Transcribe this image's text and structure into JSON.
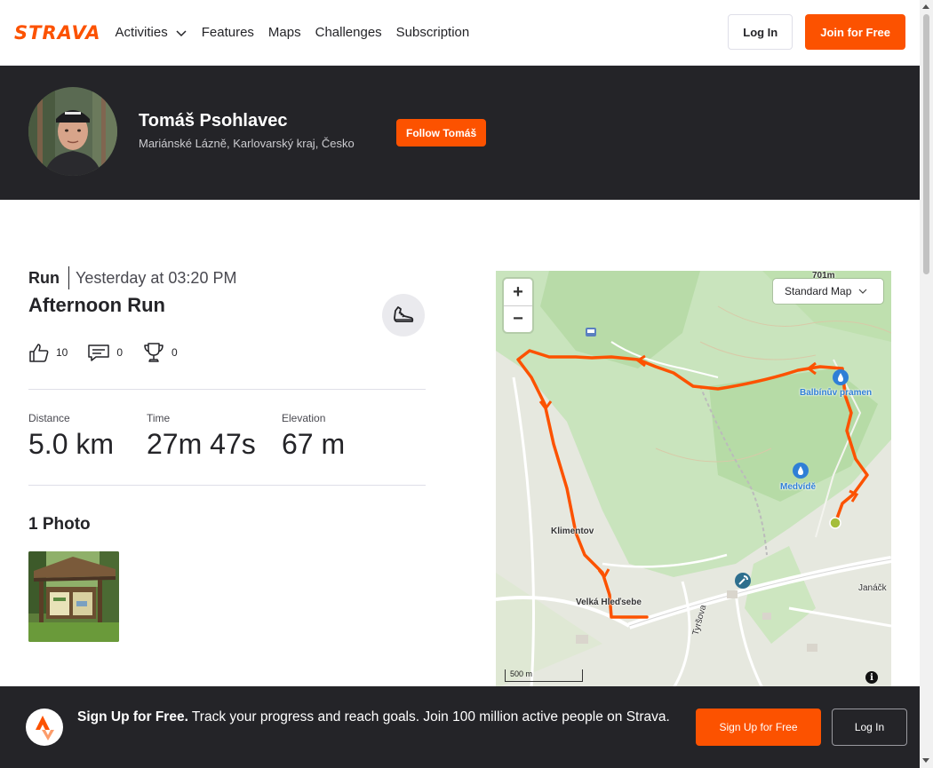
{
  "header": {
    "logo": "STRAVA",
    "nav": [
      "Activities",
      "Features",
      "Maps",
      "Challenges",
      "Subscription"
    ],
    "login_label": "Log In",
    "join_label": "Join for Free",
    "brand_color": "#fc5200"
  },
  "athlete": {
    "name": "Tomáš Psohlavec",
    "location": "Mariánské Lázně, Karlovarský kraj, Česko",
    "follow_label": "Follow Tomáš"
  },
  "activity": {
    "type": "Run",
    "time": "Yesterday at 03:20 PM",
    "title": "Afternoon Run",
    "kudos": "10",
    "comments": "0",
    "achievements": "0",
    "stats": [
      {
        "label": "Distance",
        "value": "5.0 km"
      },
      {
        "label": "Time",
        "value": "27m 47s"
      },
      {
        "label": "Elevation",
        "value": "67 m"
      }
    ],
    "photos_title": "1 Photo"
  },
  "map": {
    "map_type": "Standard Map",
    "scale": "500 m",
    "labels": {
      "peak": "701m",
      "balbinuv": "Balbínův pramen",
      "medvide": "Medvídě",
      "klimentov": "Klimentov",
      "hledsebe": "Velká Hleďsebe",
      "tyrsova": "Tyršova",
      "janackova": "Janáčk"
    },
    "route_color": "#fc5200"
  },
  "signup_bar": {
    "bold": "Sign Up for Free.",
    "text": " Track your progress and reach goals. Join 100 million active people on Strava.",
    "signup_label": "Sign Up for Free",
    "login_label": "Log In"
  }
}
